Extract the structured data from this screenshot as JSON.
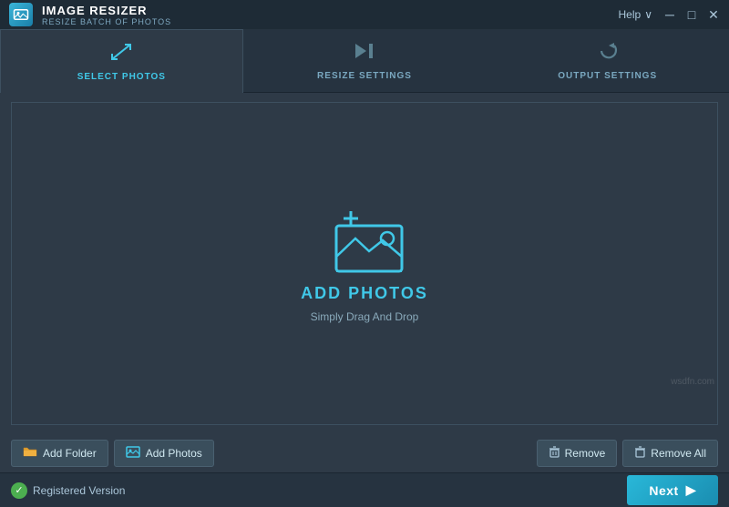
{
  "titlebar": {
    "app_name": "IMAGE RESIZER",
    "app_subtitle": "RESIZE BATCH OF PHOTOS",
    "help_label": "Help",
    "chevron": "∨",
    "minimize": "─",
    "maximize": "□",
    "close": "✕"
  },
  "tabs": [
    {
      "id": "select-photos",
      "label": "SELECT PHOTOS",
      "active": true
    },
    {
      "id": "resize-settings",
      "label": "RESIZE SETTINGS",
      "active": false
    },
    {
      "id": "output-settings",
      "label": "OUTPUT SETTINGS",
      "active": false
    }
  ],
  "main": {
    "add_photos_label": "ADD PHOTOS",
    "drag_drop_label": "Simply Drag And Drop"
  },
  "bottom_toolbar": {
    "add_folder_label": "Add Folder",
    "add_photos_label": "Add Photos",
    "remove_label": "Remove",
    "remove_all_label": "Remove All"
  },
  "status_bar": {
    "registered_label": "Registered Version",
    "next_label": "Next"
  },
  "watermark": "wsdfn.com"
}
